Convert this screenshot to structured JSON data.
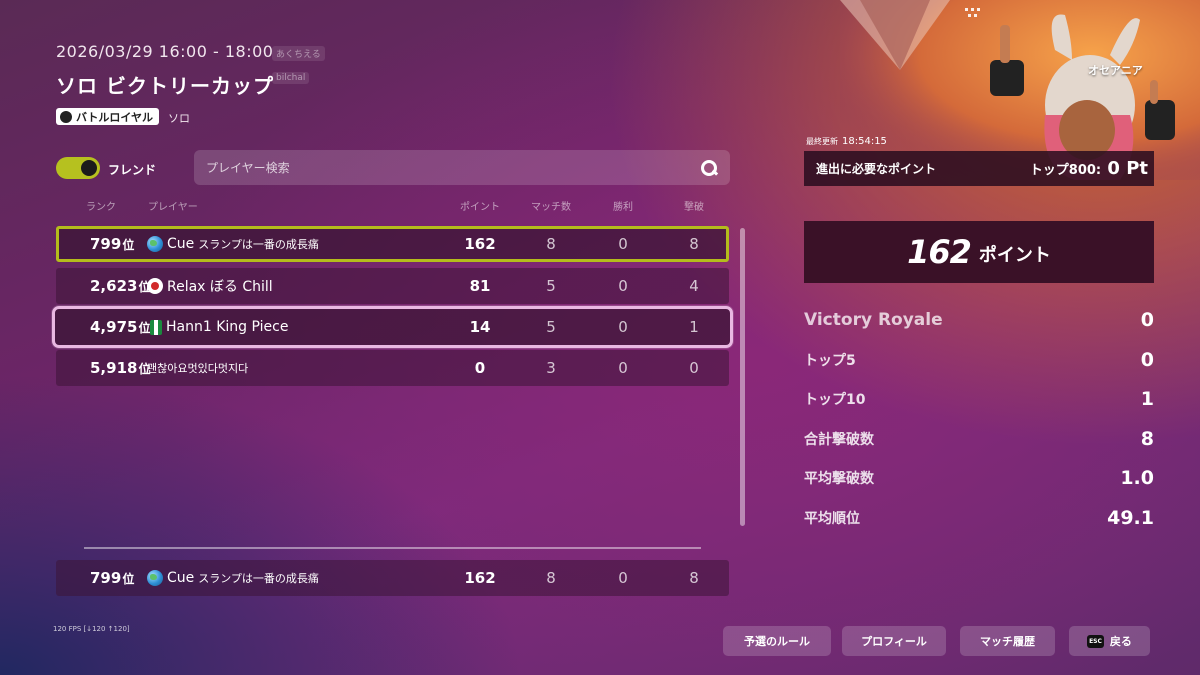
{
  "event": {
    "time": "2026/03/29 16:00 - 18:00",
    "ghost_tags": [
      "あくちえる",
      "bilchal"
    ],
    "title": "ソロ ビクトリーカップ",
    "mode_badge": "バトルロイヤル",
    "mode_type": "ソロ"
  },
  "filter": {
    "friend_label": "フレンド",
    "friend_on": true
  },
  "search": {
    "placeholder": "プレイヤー検索"
  },
  "table": {
    "headers": {
      "rank": "ランク",
      "player": "プレイヤー",
      "points": "ポイント",
      "matches": "マッチ数",
      "wins": "勝利",
      "elims": "撃破"
    },
    "rows": [
      {
        "rank": "799",
        "rank_unit": "位",
        "flag": "globe-icon",
        "name": "Cue",
        "name_jp": "スランプは一番の成長痛",
        "points": "162",
        "matches": "8",
        "wins": "0",
        "elims": "8",
        "highlight": "self"
      },
      {
        "rank": "2,623",
        "rank_unit": "位",
        "flag": "japan-flag-icon",
        "name": "Relax ぼる Chill",
        "name_jp": "",
        "points": "81",
        "matches": "5",
        "wins": "0",
        "elims": "4",
        "highlight": "none"
      },
      {
        "rank": "4,975",
        "rank_unit": "位",
        "flag": "nigeria-flag-icon",
        "name": "Hann1 King Piece",
        "name_jp": "",
        "points": "14",
        "matches": "5",
        "wins": "0",
        "elims": "1",
        "highlight": "selected"
      },
      {
        "rank": "5,918",
        "rank_unit": "位",
        "flag": "",
        "name": "괜찮아요멋있다멋지다",
        "name_jp": "",
        "points": "0",
        "matches": "3",
        "wins": "0",
        "elims": "0",
        "highlight": "none"
      }
    ],
    "self_row": {
      "rank": "799",
      "rank_unit": "位",
      "flag": "globe-icon",
      "name": "Cue",
      "name_jp": "スランプは一番の成長痛",
      "points": "162",
      "matches": "8",
      "wins": "0",
      "elims": "8"
    }
  },
  "fps": "120 FPS [↓120 ↑120]",
  "panel": {
    "region": "オセアニア",
    "updated_label": "最終更新",
    "updated_time": "18:54:15",
    "requirement_label": "進出に必要なポイント",
    "requirement_prefix": "トップ800:",
    "requirement_value": "0 Pt",
    "total_points": "162",
    "total_points_label": "ポイント",
    "stats": [
      {
        "label": "Victory Royale",
        "value": "0"
      },
      {
        "label": "トップ5",
        "value": "0"
      },
      {
        "label": "トップ10",
        "value": "1"
      },
      {
        "label": "合計撃破数",
        "value": "8"
      },
      {
        "label": "平均撃破数",
        "value": "1.0"
      },
      {
        "label": "平均順位",
        "value": "49.1"
      }
    ]
  },
  "buttons": {
    "rules": "予選のルール",
    "profile": "プロフィール",
    "history": "マッチ履歴",
    "back_key": "ESC",
    "back": "戻る"
  },
  "colors": {
    "self_highlight": "#b4bc1c",
    "selected_highlight": "#e9b8e2",
    "toggle_on": "#b6c11f"
  }
}
